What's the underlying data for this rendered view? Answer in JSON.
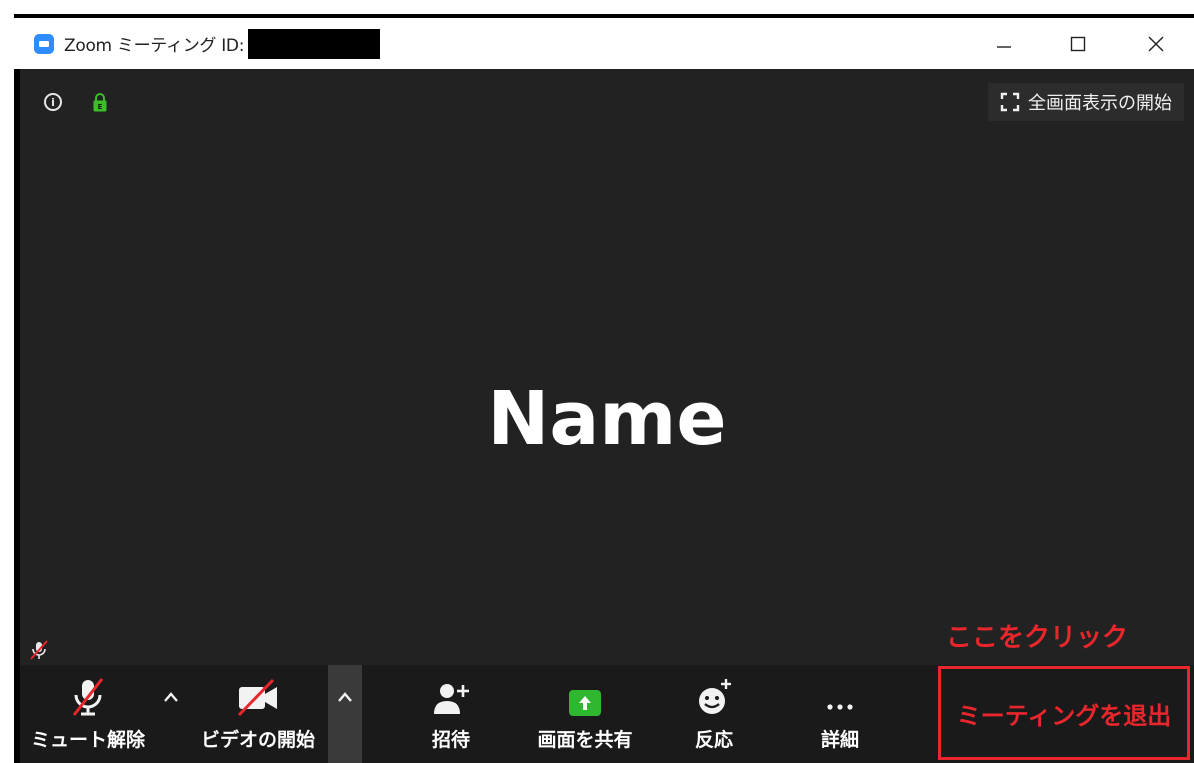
{
  "window": {
    "title": "Zoom ミーティング ID:",
    "controls": {
      "minimize": "—",
      "maximize": "☐",
      "close": "✕"
    }
  },
  "stage": {
    "fullscreen_label": "全画面表示の開始",
    "participant_name": "Name"
  },
  "annotation": {
    "text": "ここをクリック"
  },
  "toolbar": {
    "unmute_label": "ミュート解除",
    "start_video_label": "ビデオの開始",
    "invite_label": "招待",
    "share_screen_label": "画面を共有",
    "reactions_label": "反応",
    "more_label": "詳細",
    "leave_label": "ミーティングを退出"
  },
  "colors": {
    "zoom_blue": "#2D8CFF",
    "share_green": "#2FB72F",
    "lock_green": "#3DBE29",
    "annotation_red": "#E8262C",
    "stage_bg": "#222222",
    "toolbar_bg": "#1A1A1A"
  },
  "icons": {
    "info": "info-icon",
    "lock": "lock-icon",
    "fullscreen": "fullscreen-icon",
    "mic_muted": "mic-muted-icon",
    "video_off": "video-off-icon",
    "invite": "add-user-icon",
    "share": "share-arrow-icon",
    "reaction": "smiley-plus-icon",
    "more": "ellipsis-icon"
  }
}
